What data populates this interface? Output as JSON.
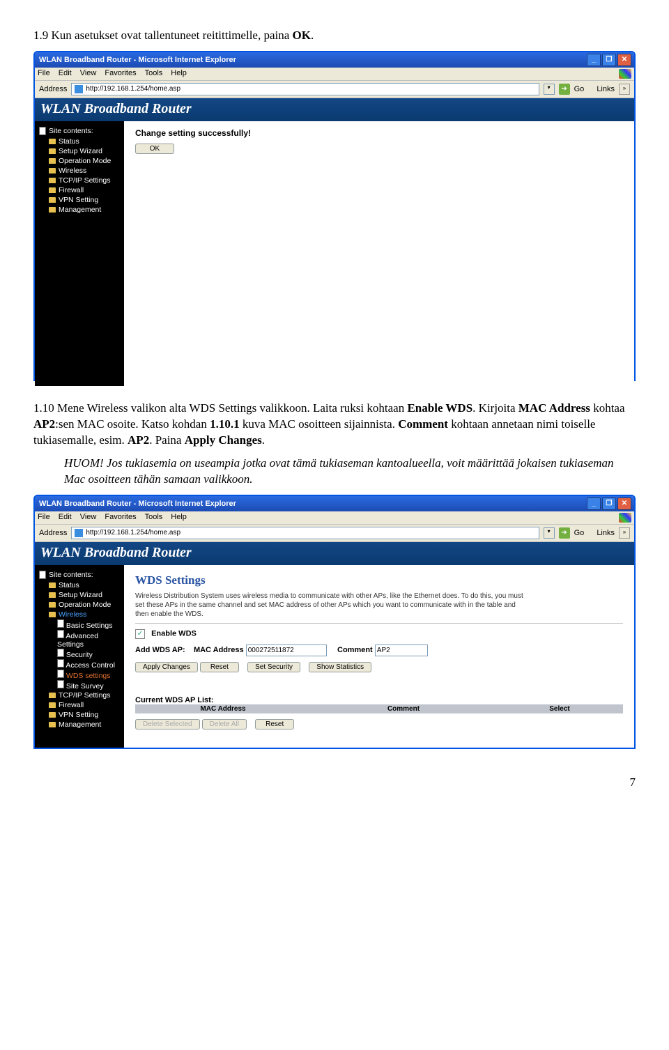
{
  "step1": {
    "prefix": "1.9 Kun asetukset ovat tallentuneet reitittimelle, paina ",
    "bold": "OK",
    "suffix": "."
  },
  "ie": {
    "title": "WLAN Broadband Router - Microsoft Internet Explorer",
    "menu": [
      "File",
      "Edit",
      "View",
      "Favorites",
      "Tools",
      "Help"
    ],
    "address_label": "Address",
    "url": "http://192.168.1.254/home.asp",
    "go": "Go",
    "links": "Links"
  },
  "banner": "WLAN Broadband Router",
  "sidebar1": {
    "head": "Site contents:",
    "items": [
      "Status",
      "Setup Wizard",
      "Operation Mode",
      "Wireless",
      "TCP/IP Settings",
      "Firewall",
      "VPN Setting",
      "Management"
    ]
  },
  "content1": {
    "heading": "Change setting successfully!",
    "ok": "OK"
  },
  "step2": {
    "line1a": "1.10 Mene Wireless valikon alta WDS Settings valikkoon. Laita ruksi kohtaan ",
    "line1b": "Enable WDS",
    "line1c": ". Kirjoita ",
    "line1d": "MAC Address",
    "line1e": " kohtaa ",
    "line1f": "AP2",
    "line1g": ":sen MAC osoite. Katso kohdan ",
    "line1h": "1.10.1",
    "line1i": " kuva MAC osoitteen sijainnista. ",
    "line1j": "Comment",
    "line1k": " kohtaan annetaan nimi toiselle tukiasemalle, esim. ",
    "line1l": "AP2",
    "line1m": ". Paina ",
    "line1n": "Apply Changes",
    "line1o": "."
  },
  "huom": {
    "lead": "HUOM! ",
    "body": "Jos tukiasemia on useampia jotka ovat tämä tukiaseman kantoalueella, voit määrittää jokaisen tukiaseman Mac osoitteen tähän samaan valikkoon."
  },
  "sidebar2": {
    "head": "Site contents:",
    "items_top": [
      "Status",
      "Setup Wizard",
      "Operation Mode"
    ],
    "wireless": "Wireless",
    "wireless_sub": [
      "Basic Settings",
      "Advanced Settings",
      "Security",
      "Access Control",
      "WDS settings",
      "Site Survey"
    ],
    "items_bottom": [
      "TCP/IP Settings",
      "Firewall",
      "VPN Setting",
      "Management"
    ]
  },
  "content2": {
    "heading": "WDS Settings",
    "desc": "Wireless Distribution System uses wireless media to communicate with other APs, like the Ethernet does. To do this, you must set these APs in the same channel and set MAC address of other APs which you want to communicate with in the table and then enable the WDS.",
    "enable_label": "Enable WDS",
    "add_label": "Add WDS AP:",
    "mac_label": "MAC Address",
    "mac_value": "000272511872",
    "comment_label": "Comment",
    "comment_value": "AP2",
    "buttons": [
      "Apply Changes",
      "Reset",
      "Set Security",
      "Show Statistics"
    ],
    "list_title": "Current WDS AP List:",
    "list_headers": [
      "MAC Address",
      "Comment",
      "Select"
    ],
    "bottom_buttons": [
      "Delete Selected",
      "Delete All",
      "Reset"
    ]
  },
  "page_num": "7"
}
